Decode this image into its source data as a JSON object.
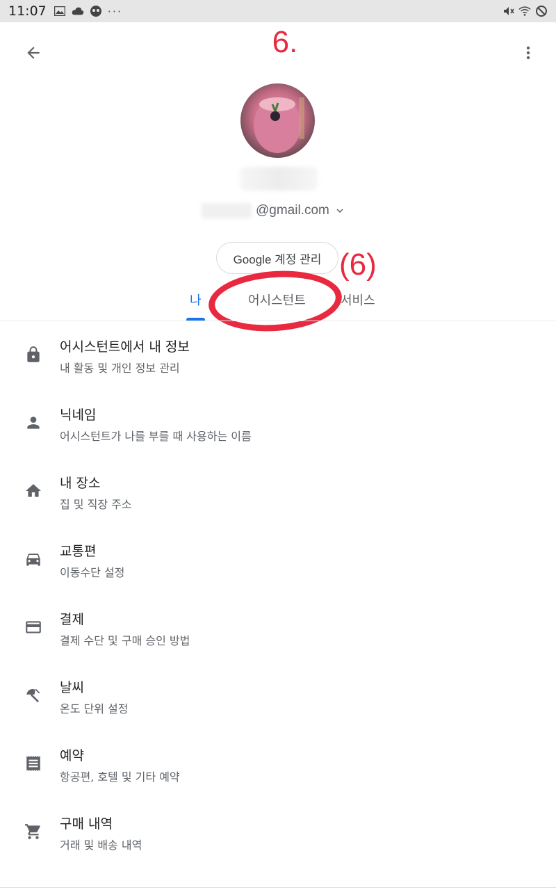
{
  "status_bar": {
    "time": "11:07",
    "left_icons": [
      "image-icon",
      "cloud-icon",
      "app-icon",
      "more-dots-icon"
    ],
    "overflow_dots": "···",
    "right_icons": [
      "mute-vibrate-icon",
      "wifi-icon",
      "do-not-disturb-icon"
    ]
  },
  "annotation": {
    "step_number": "6.",
    "label": "(6)",
    "color": "#e8293f"
  },
  "header": {
    "back_icon": "arrow-back-icon",
    "more_icon": "more-vert-icon"
  },
  "account": {
    "email": "@gmail.com",
    "manage_button": "Google 계정 관리"
  },
  "tabs": [
    {
      "label": "나",
      "selected": true
    },
    {
      "label": "어시스턴트",
      "selected": false
    },
    {
      "label": "서비스",
      "selected": false
    }
  ],
  "accent_color": "#1a73e8",
  "settings": [
    {
      "icon": "lock-icon",
      "title": "어시스턴트에서 내 정보",
      "subtitle": "내 활동 및 개인 정보 관리"
    },
    {
      "icon": "person-icon",
      "title": "닉네임",
      "subtitle": "어시스턴트가 나를 부를 때 사용하는 이름"
    },
    {
      "icon": "home-icon",
      "title": "내 장소",
      "subtitle": "집 및 직장 주소"
    },
    {
      "icon": "car-icon",
      "title": "교통편",
      "subtitle": "이동수단 설정"
    },
    {
      "icon": "credit-card-icon",
      "title": "결제",
      "subtitle": "결제 수단 및 구매 승인 방법"
    },
    {
      "icon": "weather-icon",
      "title": "날씨",
      "subtitle": "온도 단위 설정"
    },
    {
      "icon": "receipt-icon",
      "title": "예약",
      "subtitle": "항공편, 호텔 및 기타 예약"
    },
    {
      "icon": "cart-icon",
      "title": "구매 내역",
      "subtitle": "거래 및 배송 내역"
    }
  ]
}
